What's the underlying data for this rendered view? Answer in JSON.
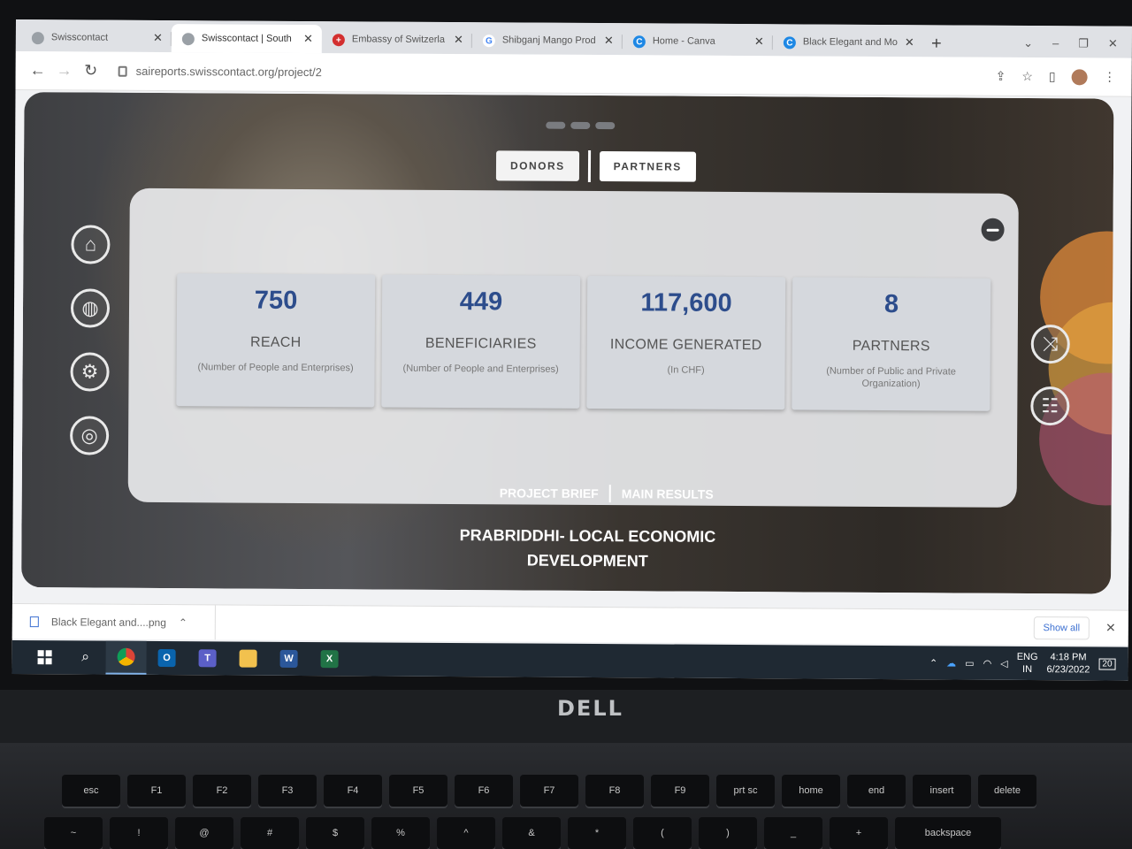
{
  "browser": {
    "tabs": [
      {
        "title": "Swisscontact",
        "fav_color": "#9aa0a6",
        "fav_glyph": ""
      },
      {
        "title": "Swisscontact | South",
        "fav_color": "#9aa0a6",
        "fav_glyph": ""
      },
      {
        "title": "Embassy of Switzerla",
        "fav_color": "#d32f2f",
        "fav_glyph": "+"
      },
      {
        "title": "Shibganj Mango Prod",
        "fav_color": "#4285f4",
        "fav_glyph": "G"
      },
      {
        "title": "Home - Canva",
        "fav_color": "#1e88e5",
        "fav_glyph": "C"
      },
      {
        "title": "Black Elegant and Mo",
        "fav_color": "#1e88e5",
        "fav_glyph": "C"
      }
    ],
    "active_tab_index": 1,
    "url": "saireports.swisscontact.org/project/2"
  },
  "page": {
    "top_tabs": [
      "DONORS",
      "PARTNERS"
    ],
    "stats": [
      {
        "value": "750",
        "label": "REACH",
        "sub": "(Number of People and Enterprises)"
      },
      {
        "value": "449",
        "label": "BENEFICIARIES",
        "sub": "(Number of People and Enterprises)"
      },
      {
        "value": "117,600",
        "label": "INCOME GENERATED",
        "sub": "(In CHF)"
      },
      {
        "value": "8",
        "label": "PARTNERS",
        "sub": "(Number of Public and Private Organization)"
      }
    ],
    "bottom_links": [
      "PROJECT BRIEF",
      "MAIN RESULTS"
    ],
    "project_title": "PRABRIDDHI- LOCAL ECONOMIC DEVELOPMENT",
    "left_icons": [
      "home-icon",
      "globe-icon",
      "settings-cycle-icon",
      "circle-icon"
    ],
    "right_icons": [
      "handshake-icon",
      "group-icon"
    ]
  },
  "download_bar": {
    "file": "Black Elegant and....png",
    "show_all": "Show all"
  },
  "taskbar": {
    "lang_top": "ENG",
    "lang_bottom": "IN",
    "time": "4:18 PM",
    "date": "6/23/2022",
    "notification_count": "20"
  },
  "laptop": {
    "brand": "DELL",
    "fn_keys": [
      "esc",
      "F1",
      "F2",
      "F3",
      "F4",
      "F5",
      "F6",
      "F7",
      "F8",
      "F9",
      "prt sc",
      "home",
      "end",
      "insert",
      "delete"
    ],
    "num_keys": [
      "~",
      "!",
      "@",
      "#",
      "$",
      "%",
      "^",
      "&",
      "*",
      "(",
      ")",
      "_",
      "+",
      "backspace"
    ]
  },
  "colors": {
    "stat_number": "#2d4d8c",
    "accent_orange": "#e08a3a"
  }
}
